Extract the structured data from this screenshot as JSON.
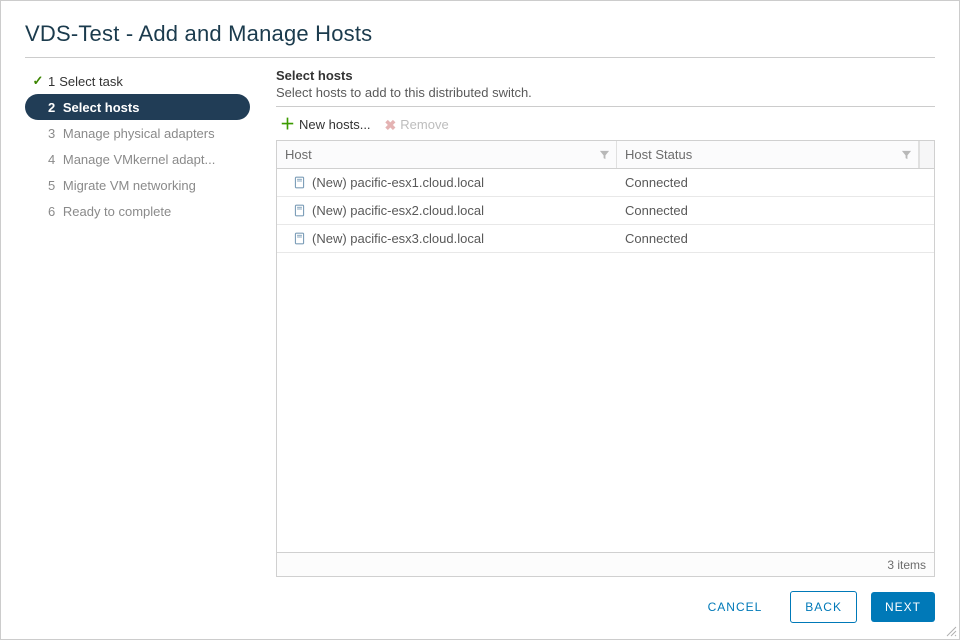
{
  "dialog_title": "VDS-Test - Add and Manage Hosts",
  "sidebar": {
    "steps": [
      {
        "num": "1",
        "label": "Select task",
        "completed": true
      },
      {
        "num": "2",
        "label": "Select hosts",
        "active": true
      },
      {
        "num": "3",
        "label": "Manage physical adapters"
      },
      {
        "num": "4",
        "label": "Manage VMkernel adapt..."
      },
      {
        "num": "5",
        "label": "Migrate VM networking"
      },
      {
        "num": "6",
        "label": "Ready to complete"
      }
    ]
  },
  "main": {
    "title": "Select hosts",
    "subtitle": "Select hosts to add to this distributed switch."
  },
  "toolbar": {
    "new_hosts_label": "New hosts...",
    "remove_label": "Remove"
  },
  "grid": {
    "columns": {
      "host": "Host",
      "status": "Host Status"
    },
    "rows": [
      {
        "host": "(New) pacific-esx1.cloud.local",
        "status": "Connected"
      },
      {
        "host": "(New) pacific-esx2.cloud.local",
        "status": "Connected"
      },
      {
        "host": "(New) pacific-esx3.cloud.local",
        "status": "Connected"
      }
    ],
    "footer": "3 items"
  },
  "buttons": {
    "cancel": "CANCEL",
    "back": "BACK",
    "next": "NEXT"
  }
}
